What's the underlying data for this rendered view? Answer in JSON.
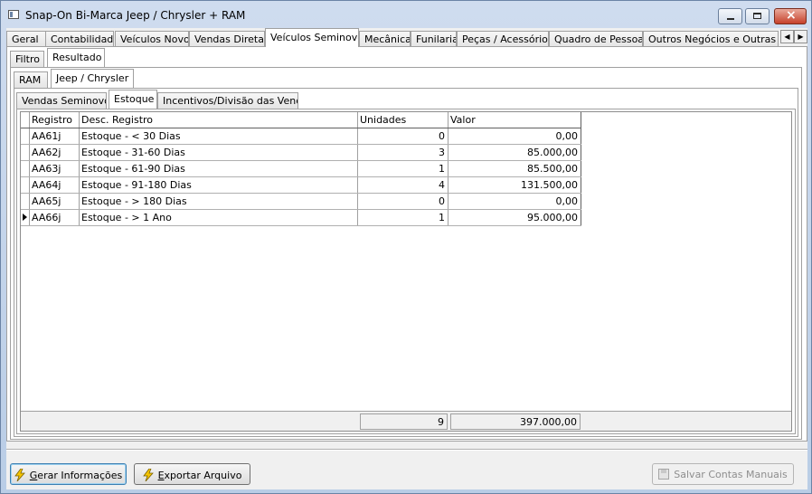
{
  "window": {
    "title": "Snap-On Bi-Marca Jeep / Chrysler + RAM"
  },
  "main_tabs": [
    {
      "label": "Geral"
    },
    {
      "label": "Contabilidade"
    },
    {
      "label": "Veículos Novos"
    },
    {
      "label": "Vendas Diretas"
    },
    {
      "label": "Veículos Seminovos",
      "active": true
    },
    {
      "label": "Mecânica"
    },
    {
      "label": "Funilaria"
    },
    {
      "label": "Peças / Acessórios"
    },
    {
      "label": "Quadro de Pessoas"
    },
    {
      "label": "Outros Negócios e Outras Mar"
    }
  ],
  "view_tabs": [
    {
      "label": "Filtro"
    },
    {
      "label": "Resultado",
      "active": true
    }
  ],
  "brand_tabs": [
    {
      "label": "RAM"
    },
    {
      "label": "Jeep / Chrysler",
      "active": true
    }
  ],
  "section_tabs": [
    {
      "label": "Vendas Seminovos"
    },
    {
      "label": "Estoque",
      "active": true
    },
    {
      "label": "Incentivos/Divisão das Vendas"
    }
  ],
  "grid": {
    "columns": [
      "Registro",
      "Desc. Registro",
      "Unidades",
      "Valor"
    ],
    "rows": [
      {
        "registro": "AA61j",
        "descricao": "Estoque - < 30 Dias",
        "unidades": "0",
        "valor": "0,00"
      },
      {
        "registro": "AA62j",
        "descricao": "Estoque - 31-60 Dias",
        "unidades": "3",
        "valor": "85.000,00"
      },
      {
        "registro": "AA63j",
        "descricao": "Estoque - 61-90 Dias",
        "unidades": "1",
        "valor": "85.500,00"
      },
      {
        "registro": "AA64j",
        "descricao": "Estoque - 91-180 Dias",
        "unidades": "4",
        "valor": "131.500,00"
      },
      {
        "registro": "AA65j",
        "descricao": "Estoque - > 180 Dias",
        "unidades": "0",
        "valor": "0,00"
      },
      {
        "registro": "AA66j",
        "descricao": "Estoque - > 1 Ano",
        "unidades": "1",
        "valor": "95.000,00",
        "current": true
      }
    ],
    "totals": {
      "unidades": "9",
      "valor": "397.000,00"
    }
  },
  "buttons": {
    "gerar_prefix": "G",
    "gerar_rest": "erar Informações",
    "exportar_prefix": "E",
    "exportar_rest": "xportar Arquivo",
    "salvar": "Salvar Contas Manuais"
  },
  "colors": {
    "accent": "#3c7fb1",
    "bolt": "#f5c400"
  }
}
